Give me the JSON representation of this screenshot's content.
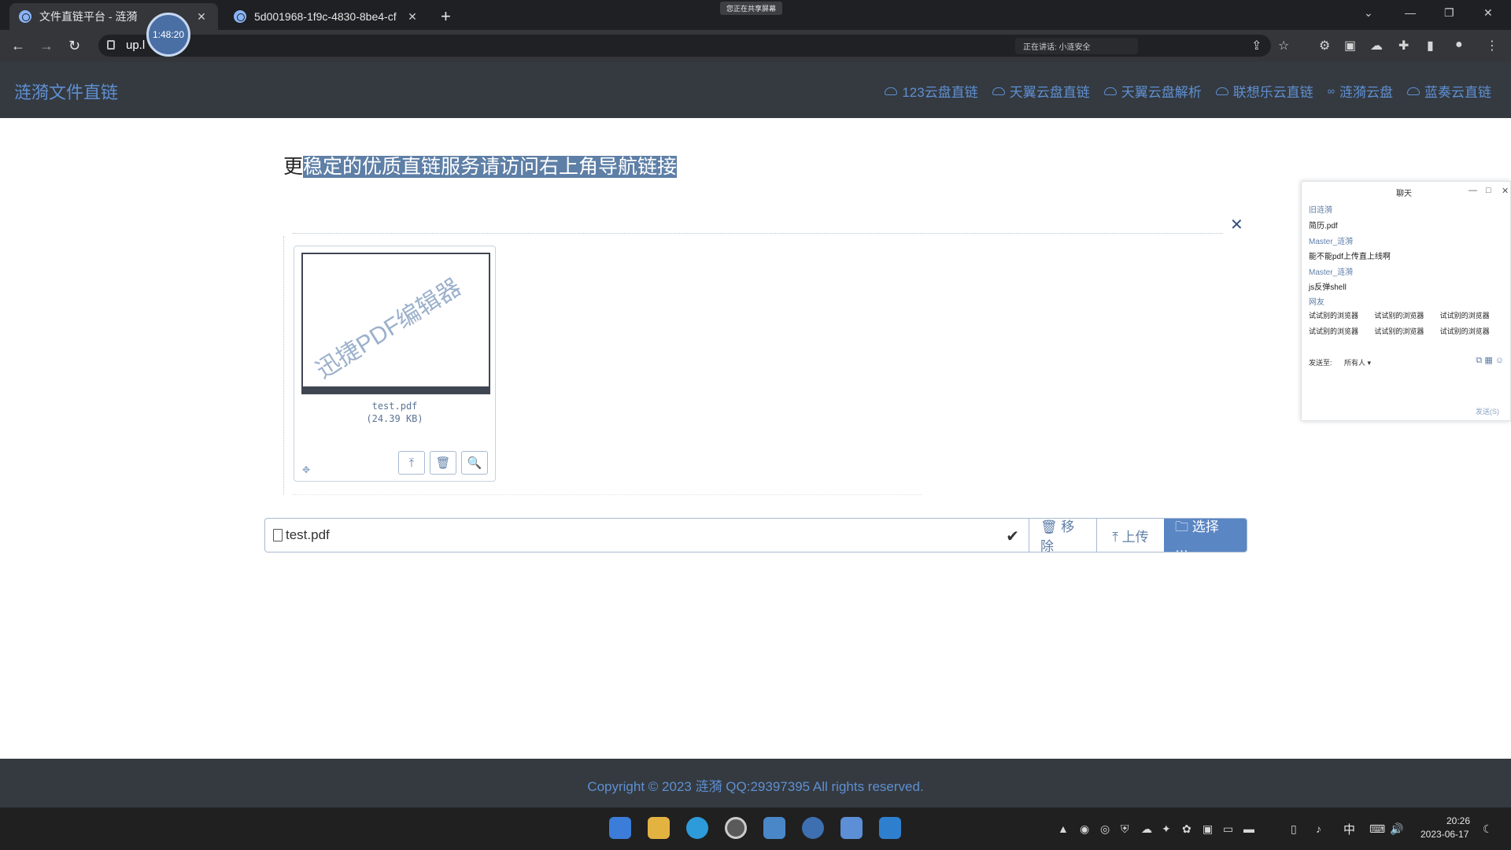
{
  "browser": {
    "tabs": [
      {
        "title": "文件直链平台 - 涟漪",
        "active": true
      },
      {
        "title": "5d001968-1f9c-4830-8be4-cf",
        "active": false
      }
    ],
    "share_pill": "您正在共享屏幕",
    "timer": "1:48:20",
    "url": "up.l",
    "sharing_note": "正在讲话: 小涟安全"
  },
  "site": {
    "title": "涟漪文件直链",
    "nav": [
      {
        "label": "123云盘直链",
        "icon": "cloud-icon"
      },
      {
        "label": "天翼云盘直链",
        "icon": "cloud-icon"
      },
      {
        "label": "天翼云盘解析",
        "icon": "cloud-icon"
      },
      {
        "label": "联想乐云直链",
        "icon": "cloud-icon"
      },
      {
        "label": "涟漪云盘",
        "icon": "link-icon"
      },
      {
        "label": "蓝奏云直链",
        "icon": "cloud-icon"
      }
    ]
  },
  "main": {
    "headline_first": "更",
    "headline_selected": "稳定的优质直链服务请访问右上角导航链接",
    "preview": {
      "watermark": "迅捷PDF编辑器",
      "file_name": "test.pdf",
      "file_size": "(24.39 KB)"
    },
    "caption_file": "test.pdf",
    "buttons": {
      "remove": "🗑 移除",
      "upload": "⤒ 上传",
      "browse": "🗀 选择 …"
    }
  },
  "chat": {
    "title": "聊天",
    "lines": [
      {
        "kind": "name",
        "text": "旧涟漪"
      },
      {
        "kind": "msg",
        "text": "简历.pdf"
      },
      {
        "kind": "name",
        "text": "Master_涟漪"
      },
      {
        "kind": "msg",
        "text": "能不能pdf上传直上线啊"
      },
      {
        "kind": "name",
        "text": "Master_涟漪"
      },
      {
        "kind": "msg",
        "text": "js反弹shell"
      },
      {
        "kind": "name",
        "text": "网友"
      }
    ],
    "grid": [
      "试试别的浏览器",
      "试试别的浏览器",
      "试试别的浏览器",
      "试试别的浏览器",
      "试试别的浏览器",
      "试试别的浏览器"
    ],
    "send_to_label": "发送至:",
    "recipient": "所有人 ▾",
    "send_label": "发送(S)"
  },
  "footer": {
    "copyright": "Copyright © 2023 涟漪 QQ:29397395 All rights reserved."
  },
  "taskbar": {
    "ime": "中",
    "time": "20:26",
    "date": "2023-06-17"
  }
}
